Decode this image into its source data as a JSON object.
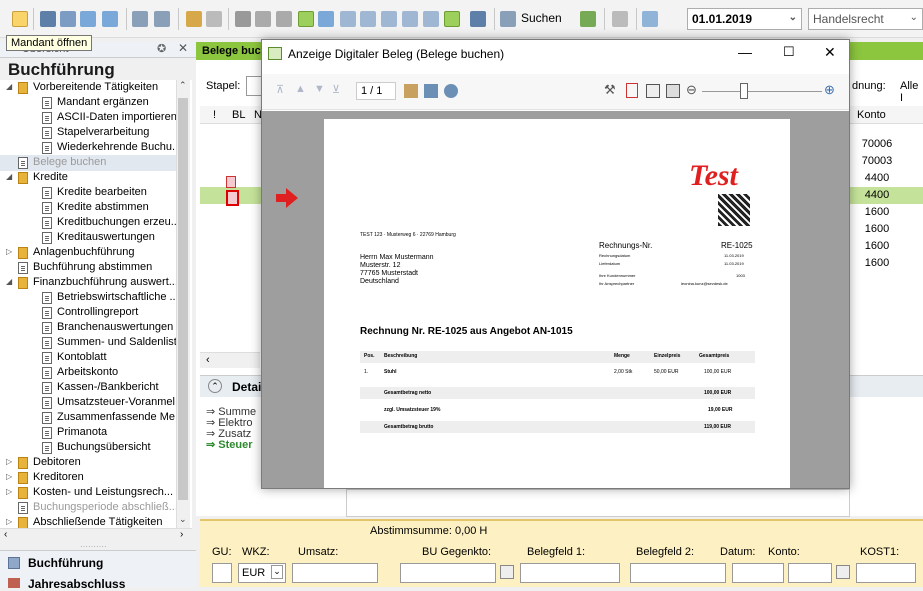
{
  "toolbar": {
    "search_label": "Suchen",
    "date_value": "01.01.2019",
    "combo_value": "Handelsrecht"
  },
  "tooltip": "Mandant öffnen",
  "left_panel": {
    "header": "Übersicht",
    "title": "Buchführung",
    "tree": [
      {
        "label": "Vorbereitende Tätigkeiten",
        "level": 0,
        "type": "folder",
        "expanded": true
      },
      {
        "label": "Mandant ergänzen",
        "level": 1,
        "type": "doc"
      },
      {
        "label": "ASCII-Daten importieren",
        "level": 1,
        "type": "doc"
      },
      {
        "label": "Stapelverarbeitung",
        "level": 1,
        "type": "doc"
      },
      {
        "label": "Wiederkehrende Buchu...",
        "level": 1,
        "type": "doc"
      },
      {
        "label": "Belege buchen",
        "level": 0,
        "type": "doc",
        "disabled": true,
        "selected": true
      },
      {
        "label": "Kredite",
        "level": 0,
        "type": "folder",
        "expanded": true
      },
      {
        "label": "Kredite bearbeiten",
        "level": 1,
        "type": "doc"
      },
      {
        "label": "Kredite abstimmen",
        "level": 1,
        "type": "doc"
      },
      {
        "label": "Kreditbuchungen erzeu...",
        "level": 1,
        "type": "doc"
      },
      {
        "label": "Kreditauswertungen",
        "level": 1,
        "type": "doc"
      },
      {
        "label": "Anlagenbuchführung",
        "level": 0,
        "type": "folder",
        "expanded": false
      },
      {
        "label": "Buchführung abstimmen",
        "level": 0,
        "type": "doc"
      },
      {
        "label": "Finanzbuchführung auswert...",
        "level": 0,
        "type": "folder",
        "expanded": true
      },
      {
        "label": "Betriebswirtschaftliche ...",
        "level": 1,
        "type": "doc"
      },
      {
        "label": "Controllingreport",
        "level": 1,
        "type": "doc"
      },
      {
        "label": "Branchenauswertungen",
        "level": 1,
        "type": "doc"
      },
      {
        "label": "Summen- und Saldenliste",
        "level": 1,
        "type": "doc"
      },
      {
        "label": "Kontoblatt",
        "level": 1,
        "type": "doc"
      },
      {
        "label": "Arbeitskonto",
        "level": 1,
        "type": "doc"
      },
      {
        "label": "Kassen-/Bankbericht",
        "level": 1,
        "type": "doc"
      },
      {
        "label": "Umsatzsteuer-Voranmel...",
        "level": 1,
        "type": "doc"
      },
      {
        "label": "Zusammenfassende Me...",
        "level": 1,
        "type": "doc"
      },
      {
        "label": "Primanota",
        "level": 1,
        "type": "doc"
      },
      {
        "label": "Buchungsübersicht",
        "level": 1,
        "type": "doc"
      },
      {
        "label": "Debitoren",
        "level": 0,
        "type": "folder",
        "expanded": false
      },
      {
        "label": "Kreditoren",
        "level": 0,
        "type": "folder",
        "expanded": false
      },
      {
        "label": "Kosten- und Leistungsrech...",
        "level": 0,
        "type": "folder",
        "expanded": false
      },
      {
        "label": "Buchungsperiode abschließ...",
        "level": 0,
        "type": "doc",
        "disabled": true
      },
      {
        "label": "Abschließende Tätigkeiten",
        "level": 0,
        "type": "folder",
        "expanded": false
      }
    ],
    "bottom_label_1": "Buchführung",
    "bottom_label_2": "Jahresabschluss"
  },
  "main": {
    "tab_title": "Belege buc",
    "stapel_label": "Stapel:",
    "ordnung_label": "dnung:",
    "ordnung_value": "Alle I",
    "col_bang": "!",
    "col_bl": "BL",
    "col_n": "N",
    "col_konto": "Konto",
    "konto_values": [
      "70006",
      "70003",
      "4400",
      "4400",
      "1600",
      "1600",
      "1600",
      "1600"
    ],
    "detail_title": "Detai",
    "detail_items": [
      "Summe",
      "Elektro",
      "Zusatz",
      "Steuer"
    ],
    "abstimm": "Abstimmsumme: 0,00 H",
    "field_labels": {
      "gu": "GU:",
      "wkz": "WKZ:",
      "umsatz": "Umsatz:",
      "gegenkonto": "BU Gegenkto:",
      "belegfeld1": "Belegfeld 1:",
      "belegfeld2": "Belegfeld 2:",
      "datum": "Datum:",
      "konto": "Konto:",
      "kost1": "KOST1:"
    },
    "currency": "EUR"
  },
  "dialog": {
    "title": "Anzeige Digitaler Beleg (Belege buchen)",
    "page_indicator": "1 / 1",
    "doc": {
      "logo": "Test",
      "sender_line": "TEST 123 · Musterweg 6 · 22769 Hamburg",
      "recipient": [
        "Herrn Max Mustermann",
        "Musterstr. 12",
        "77765 Musterstadt",
        "Deutschland"
      ],
      "invoice_no_label": "Rechnungs-Nr.",
      "invoice_no": "RE-1025",
      "meta": [
        {
          "k": "Rechnungsdatum",
          "v": "11.03.2019"
        },
        {
          "k": "Lieferdatum",
          "v": "11.03.2019"
        },
        {
          "k": "Ihre Kundennummer",
          "v": "1003"
        },
        {
          "k": "Ihr Ansprechpartner",
          "v": "leonina.kunz@sevdesk.de"
        }
      ],
      "heading": "Rechnung Nr. RE-1025 aus Angebot AN-1015",
      "table_headers": [
        "Pos.",
        "Beschreibung",
        "Menge",
        "Einzelpreis",
        "Gesamtpreis"
      ],
      "table_row": [
        "1.",
        "Stuhl",
        "2,00 Stk",
        "50,00 EUR",
        "100,00 EUR"
      ],
      "net_label": "Gesamtbetrag netto",
      "net_value": "100,00 EUR",
      "vat_label": "zzgl. Umsatzsteuer 19%",
      "vat_value": "19,00 EUR",
      "gross_label": "Gesamtbetrag brutto",
      "gross_value": "119,00 EUR"
    }
  },
  "colors": {
    "accent_green": "#8cc63f",
    "highlight_row": "#c5e29a",
    "dialog_bg": "#9e9e9e",
    "logo_red": "#e02020",
    "bottom_panel": "#fdf0c2"
  }
}
